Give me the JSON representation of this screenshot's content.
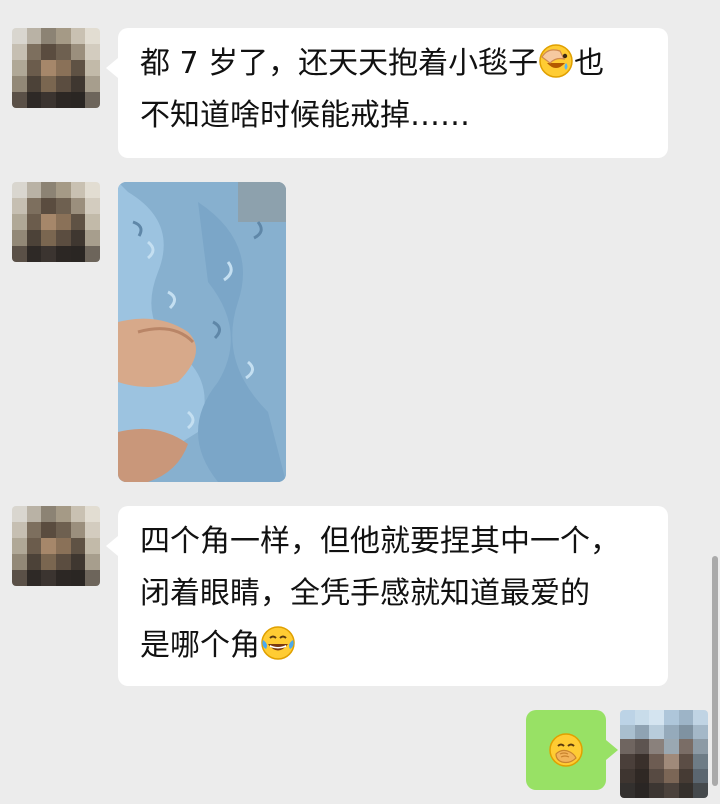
{
  "messages": [
    {
      "lines": [
        "都 7 岁了，还天天抱着小毯子",
        "也",
        "不知道啥时候能戒掉……"
      ],
      "emoji": "facepalm-emoji"
    },
    {
      "type": "image",
      "image_subject": "blue-blanket-photo"
    },
    {
      "lines": [
        "四个角一样，但他就要捏其中一个，",
        "闭着眼睛，全凭手感就知道最爱的",
        "是哪个角"
      ],
      "emoji": "tears-of-joy-emoji"
    },
    {
      "mine": true,
      "emoji": "hand-over-mouth-emoji"
    }
  ],
  "colors": {
    "background": "#ececec",
    "incoming_bubble": "#ffffff",
    "outgoing_bubble": "#98e165"
  }
}
